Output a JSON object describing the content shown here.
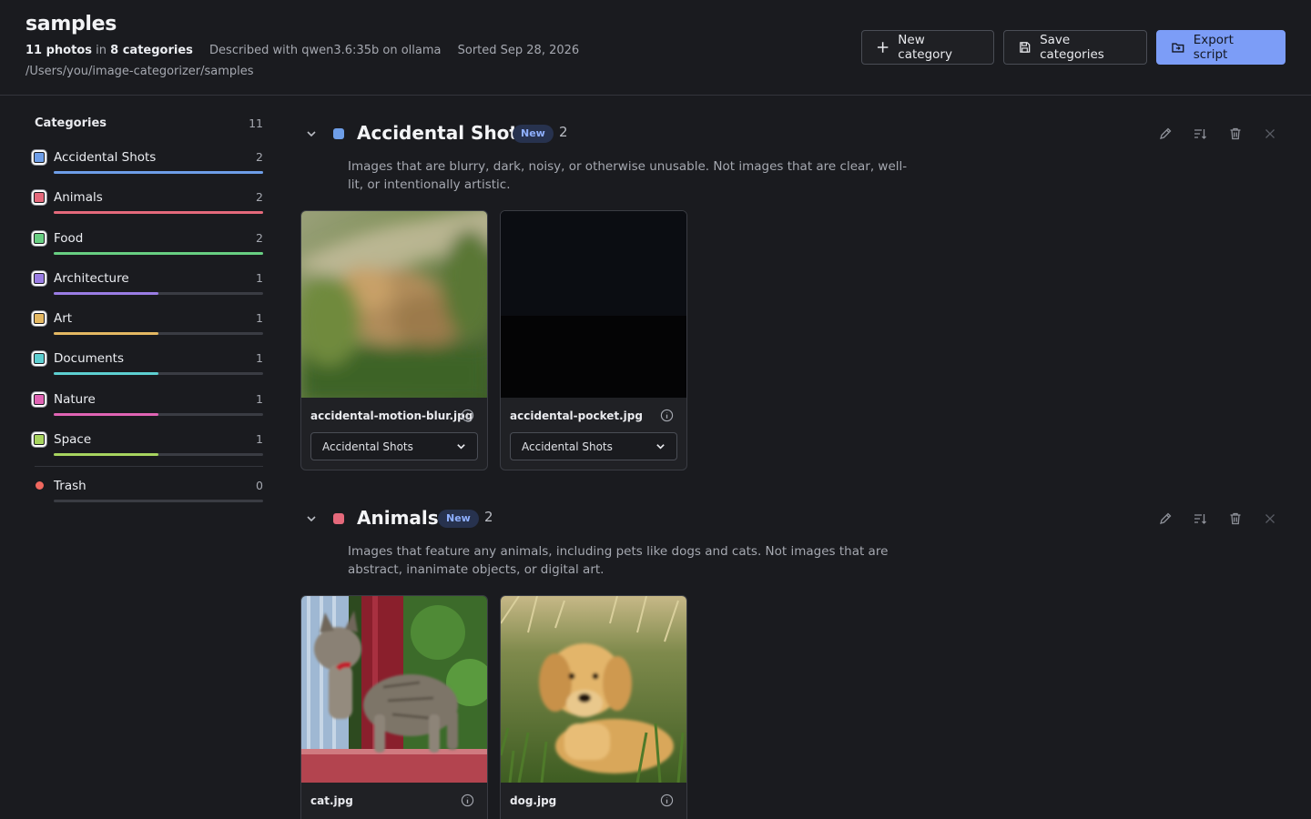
{
  "header": {
    "title": "samples",
    "photo_count": "11 photos",
    "in_word": "in",
    "category_count": "8 categories",
    "described": "Described with qwen3.6:35b on ollama",
    "sorted": "Sorted Sep 28, 2026",
    "path": "/Users/you/image-categorizer/samples",
    "new_category": "New category",
    "save_categories": "Save categories",
    "export_script": "Export script"
  },
  "sidebar": {
    "heading": "Categories",
    "total": "11",
    "items": [
      {
        "label": "Accidental Shots",
        "count": "2",
        "color": "#6e9ee8",
        "fraction": 1.0
      },
      {
        "label": "Animals",
        "count": "2",
        "color": "#e5697b",
        "fraction": 1.0
      },
      {
        "label": "Food",
        "count": "2",
        "color": "#68cf82",
        "fraction": 1.0
      },
      {
        "label": "Architecture",
        "count": "1",
        "color": "#9a7de4",
        "fraction": 0.5
      },
      {
        "label": "Art",
        "count": "1",
        "color": "#e4b862",
        "fraction": 0.5
      },
      {
        "label": "Documents",
        "count": "1",
        "color": "#5dcfd1",
        "fraction": 0.5
      },
      {
        "label": "Nature",
        "count": "1",
        "color": "#e064b4",
        "fraction": 0.5
      },
      {
        "label": "Space",
        "count": "1",
        "color": "#a7d45f",
        "fraction": 0.5
      }
    ],
    "trash": {
      "label": "Trash",
      "count": "0",
      "color": "#f0685f"
    }
  },
  "sections": [
    {
      "title": "Accidental Shots",
      "badge": "New",
      "count": "2",
      "color": "#6e9ee8",
      "description": "Images that are blurry, dark, noisy, or otherwise unusable. Not images that are clear, well-lit, or intentionally artistic.",
      "cards": [
        {
          "filename": "accidental-motion-blur.jpg",
          "category": "Accidental Shots"
        },
        {
          "filename": "accidental-pocket.jpg",
          "category": "Accidental Shots"
        }
      ]
    },
    {
      "title": "Animals",
      "badge": "New",
      "count": "2",
      "color": "#e5697b",
      "description": "Images that feature any animals, including pets like dogs and cats. Not images that are abstract, inanimate objects, or digital art.",
      "cards": [
        {
          "filename": "cat.jpg",
          "category": "Animals"
        },
        {
          "filename": "dog.jpg",
          "category": "Animals"
        }
      ]
    }
  ]
}
